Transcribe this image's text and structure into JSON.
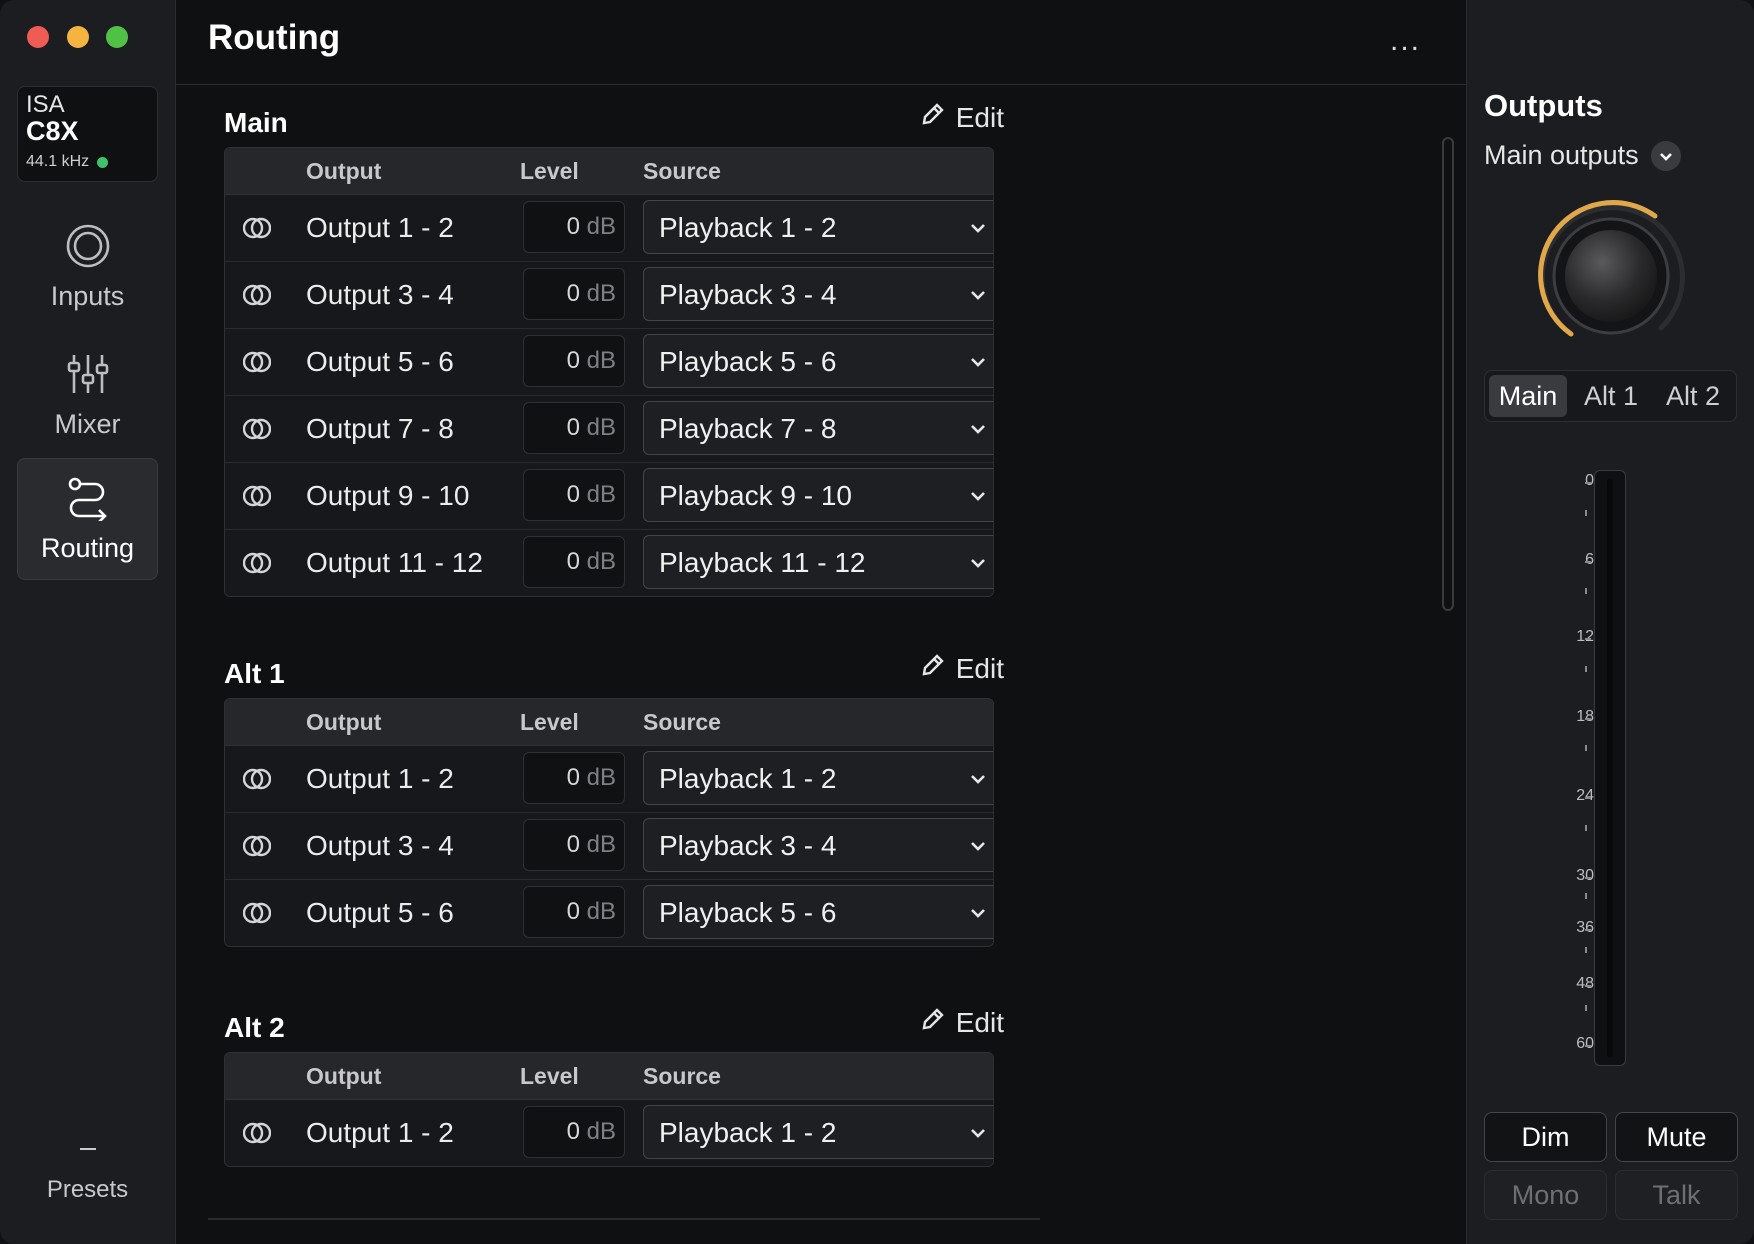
{
  "sidebar": {
    "device": {
      "brand": "ISA",
      "model": "C8X",
      "rate": "44.1 kHz"
    },
    "nav": [
      {
        "label": "Inputs",
        "icon": "inputs-icon"
      },
      {
        "label": "Mixer",
        "icon": "mixer-icon"
      },
      {
        "label": "Routing",
        "icon": "routing-icon",
        "active": true
      }
    ],
    "presets": "Presets"
  },
  "header": {
    "title": "Routing",
    "more": "..."
  },
  "columns": {
    "output": "Output",
    "level": "Level",
    "source": "Source"
  },
  "edit_label": "Edit",
  "level_unit": "dB",
  "sections": [
    {
      "title": "Main",
      "rows": [
        {
          "output": "Output 1 - 2",
          "level": "0",
          "source": "Playback 1 - 2"
        },
        {
          "output": "Output 3 - 4",
          "level": "0",
          "source": "Playback 3 - 4"
        },
        {
          "output": "Output 5 - 6",
          "level": "0",
          "source": "Playback 5 - 6"
        },
        {
          "output": "Output 7 - 8",
          "level": "0",
          "source": "Playback 7 - 8"
        },
        {
          "output": "Output 9 - 10",
          "level": "0",
          "source": "Playback 9 - 10"
        },
        {
          "output": "Output 11 - 12",
          "level": "0",
          "source": "Playback 11 - 12"
        }
      ]
    },
    {
      "title": "Alt 1",
      "rows": [
        {
          "output": "Output 1 - 2",
          "level": "0",
          "source": "Playback 1 - 2"
        },
        {
          "output": "Output 3 - 4",
          "level": "0",
          "source": "Playback 3 - 4"
        },
        {
          "output": "Output 5 - 6",
          "level": "0",
          "source": "Playback 5 - 6"
        }
      ]
    },
    {
      "title": "Alt 2",
      "rows": [
        {
          "output": "Output 1 - 2",
          "level": "0",
          "source": "Playback 1 - 2"
        }
      ]
    }
  ],
  "outputs_panel": {
    "title": "Outputs",
    "selector": "Main outputs",
    "tabs": [
      "Main",
      "Alt 1",
      "Alt 2"
    ],
    "active_tab": "Main",
    "scale": [
      "0",
      "6",
      "12",
      "18",
      "24",
      "30",
      "36",
      "48",
      "60"
    ],
    "buttons": {
      "dim": "Dim",
      "mute": "Mute",
      "mono": "Mono",
      "talk": "Talk"
    },
    "colors": {
      "knob_accent": "#e0a84a"
    }
  }
}
